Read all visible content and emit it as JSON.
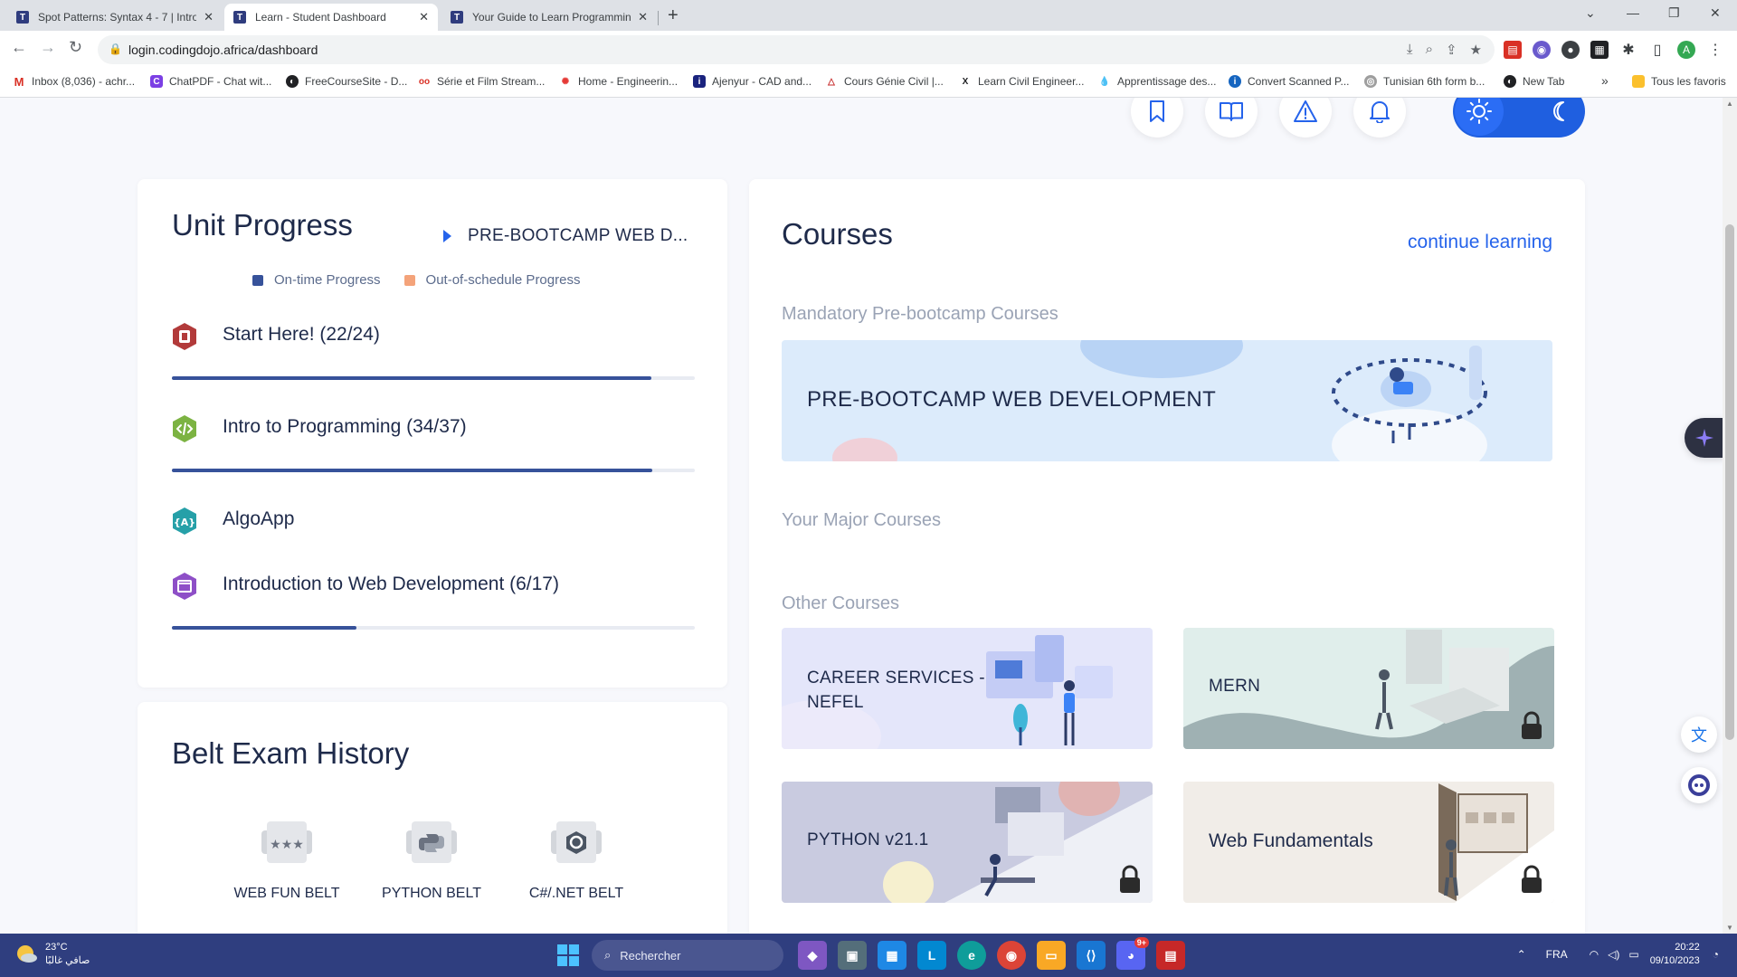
{
  "browser": {
    "tabs": [
      {
        "title": "Spot Patterns: Syntax 4 - 7 | Intro",
        "active": false
      },
      {
        "title": "Learn - Student Dashboard",
        "active": true
      },
      {
        "title": "Your Guide to Learn Programmin",
        "active": false
      }
    ],
    "url": "login.codingdojo.africa/dashboard",
    "bookmarks": [
      "Inbox (8,036) - achr...",
      "ChatPDF - Chat wit...",
      "FreeCourseSite - D...",
      "Série et Film Stream...",
      "Home - Engineerin...",
      "Ajenyur - CAD and...",
      "Cours Génie Civil |...",
      "Learn Civil Engineer...",
      "Apprentissage des...",
      "Convert Scanned P...",
      "Tunisian 6th form b...",
      "New Tab"
    ],
    "bookmarks_more": "»",
    "other_bookmarks": "Tous les favoris",
    "profile_initial": "A"
  },
  "unit_progress": {
    "title": "Unit Progress",
    "selected_unit": "PRE-BOOTCAMP WEB D...",
    "legend": [
      {
        "label": "On-time Progress",
        "color": "#37529a"
      },
      {
        "label": "Out-of-schedule Progress",
        "color": "#f4a37a"
      }
    ],
    "units": [
      {
        "label": "Start Here! (22/24)",
        "icon": "start-here-icon",
        "color": "#b23a3a",
        "progress": 0.917,
        "has_bar": true
      },
      {
        "label": "Intro to Programming (34/37)",
        "icon": "code-icon",
        "color": "#7cb342",
        "progress": 0.919,
        "has_bar": true
      },
      {
        "label": "AlgoApp",
        "icon": "algo-icon",
        "color": "#26a0a8",
        "progress": 0,
        "has_bar": false
      },
      {
        "label": "Introduction to Web Development (6/17)",
        "icon": "web-dev-icon",
        "color": "#8e4fc7",
        "progress": 0.353,
        "has_bar": true
      }
    ]
  },
  "belt_history": {
    "title": "Belt Exam History",
    "belts": [
      {
        "label": "WEB FUN BELT",
        "icon": "web-fun-belt-icon"
      },
      {
        "label": "PYTHON BELT",
        "icon": "python-belt-icon"
      },
      {
        "label": "C#/.NET BELT",
        "icon": "csharp-belt-icon"
      }
    ]
  },
  "courses": {
    "title": "Courses",
    "continue_label": "continue learning",
    "mandatory_label": "Mandatory Pre-bootcamp Courses",
    "mandatory_course": "PRE-BOOTCAMP WEB DEVELOPMENT",
    "major_label": "Your Major Courses",
    "other_label": "Other Courses",
    "other_courses": [
      {
        "label": "CAREER SERVICES - NEFEL",
        "locked": false
      },
      {
        "label": "MERN",
        "locked": true
      },
      {
        "label": "PYTHON v21.1",
        "locked": true
      },
      {
        "label": "Web Fundamentals",
        "locked": true
      }
    ]
  },
  "taskbar": {
    "temperature": "23°C",
    "weather_text": "صافي غالبًا",
    "search_placeholder": "Rechercher",
    "language": "FRA",
    "time": "20:22",
    "date": "09/10/2023",
    "discord_badge": "9+"
  }
}
